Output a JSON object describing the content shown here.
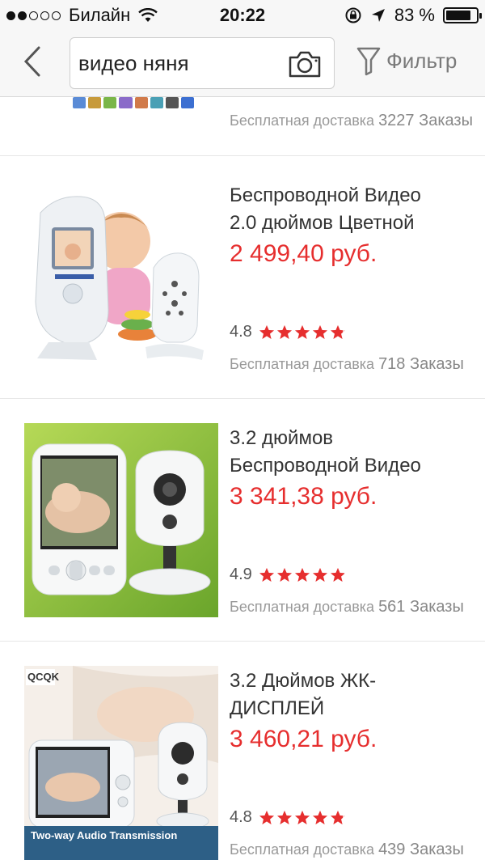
{
  "status_bar": {
    "carrier": "Билайн",
    "time": "20:22",
    "battery": "83 %",
    "battery_level": 0.83
  },
  "header": {
    "search_value": "видео няня",
    "filter_label": "Фильтр"
  },
  "partial_item": {
    "shipping": "Бесплатная доставка",
    "orders": "3227 Заказы"
  },
  "products": [
    {
      "title_line1": "Беспроводной Видео",
      "title_line2": "2.0 дюймов Цветной",
      "price": "2 499,40 руб.",
      "rating": "4.8",
      "shipping": "Бесплатная доставка",
      "orders": "718 Заказы"
    },
    {
      "title_line1": "3.2 дюймов",
      "title_line2": "Беспроводной Видео",
      "price": "3 341,38 руб.",
      "rating": "4.9",
      "shipping": "Бесплатная доставка",
      "orders": "561 Заказы"
    },
    {
      "title_line1": "3.2 Дюймов ЖК-",
      "title_line2": "ДИСПЛЕЙ",
      "price": "3 460,21 руб.",
      "rating": "4.8",
      "shipping": "Бесплатная доставка",
      "orders": "439 Заказы",
      "image_caption": "Two-way Audio Transmission"
    }
  ],
  "colors": {
    "price": "#e62e2e",
    "star": "#e62e2e",
    "header_bg": "#f7f7f7"
  }
}
